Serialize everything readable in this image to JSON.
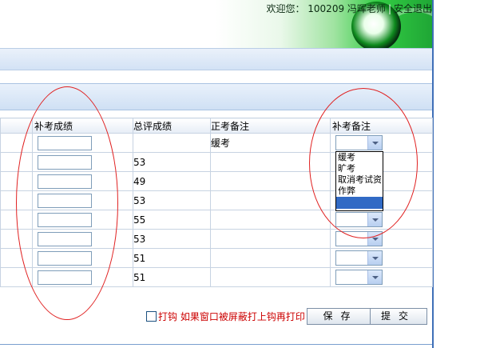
{
  "header": {
    "welcome": "欢迎您：",
    "user_id": "100209",
    "user_name": "冯晖老师",
    "separator": "|",
    "logout": "安全退出"
  },
  "table": {
    "columns": [
      "补考成绩",
      "总评成绩",
      "正考备注",
      "补考备注"
    ],
    "rows": [
      {
        "total": "",
        "remark": "缓考"
      },
      {
        "total": "53",
        "remark": ""
      },
      {
        "total": "49",
        "remark": ""
      },
      {
        "total": "53",
        "remark": ""
      },
      {
        "total": "55",
        "remark": ""
      },
      {
        "total": "53",
        "remark": ""
      },
      {
        "total": "51",
        "remark": ""
      },
      {
        "total": "51",
        "remark": ""
      }
    ]
  },
  "dropdown": {
    "options": [
      "缓考",
      "旷考",
      "取消考试资",
      "作弊",
      ""
    ]
  },
  "footer": {
    "hook_label": "打钩",
    "hint": "如果窗口被屏蔽打上钩再打印",
    "save": "保存",
    "submit": "提交"
  },
  "colors": {
    "annotation": "#e02020",
    "note": "#cc0000",
    "selection": "#316ac5"
  }
}
